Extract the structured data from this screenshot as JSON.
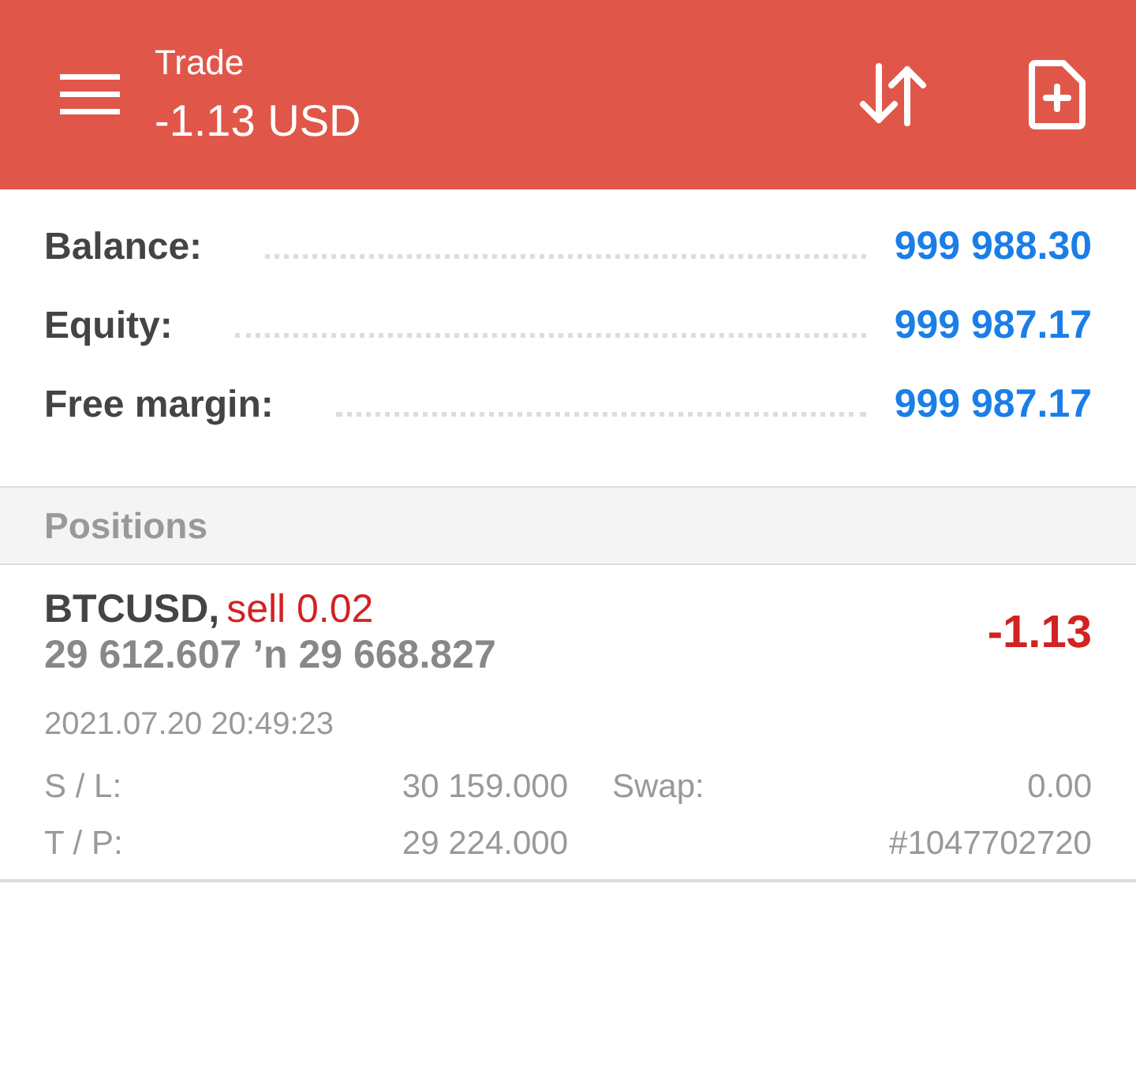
{
  "header": {
    "title": "Trade",
    "subtitle": "-1.13 USD"
  },
  "account": [
    {
      "label": "Balance:",
      "value": "999 988.30"
    },
    {
      "label": "Equity:",
      "value": "999 987.17"
    },
    {
      "label": "Free margin:",
      "value": "999 987.17"
    }
  ],
  "positions_header": "Positions",
  "positions": [
    {
      "symbol": "BTCUSD,",
      "side": "sell 0.02",
      "prices": "29 612.607 ’n  29 668.827",
      "profit": "-1.13",
      "time": "2021.07.20 20:49:23",
      "sl_label": "S / L:",
      "sl": "30 159.000",
      "swap_label": "Swap:",
      "swap": "0.00",
      "tp_label": "T / P:",
      "tp": "29 224.000",
      "ticket": "#1047702720"
    }
  ]
}
